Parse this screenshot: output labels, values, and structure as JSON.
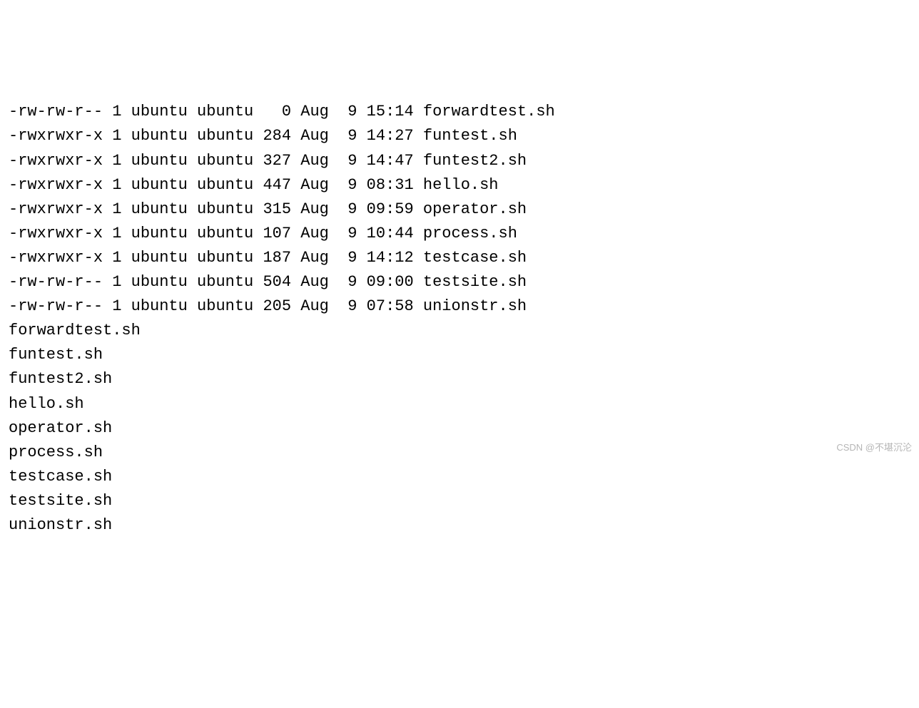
{
  "ls_long": [
    {
      "perms": "-rw-rw-r--",
      "links": "1",
      "owner": "ubuntu",
      "group": "ubuntu",
      "size": "0",
      "month": "Aug",
      "day": "9",
      "time": "15:14",
      "name": "forwardtest.sh"
    },
    {
      "perms": "-rwxrwxr-x",
      "links": "1",
      "owner": "ubuntu",
      "group": "ubuntu",
      "size": "284",
      "month": "Aug",
      "day": "9",
      "time": "14:27",
      "name": "funtest.sh"
    },
    {
      "perms": "-rwxrwxr-x",
      "links": "1",
      "owner": "ubuntu",
      "group": "ubuntu",
      "size": "327",
      "month": "Aug",
      "day": "9",
      "time": "14:47",
      "name": "funtest2.sh"
    },
    {
      "perms": "-rwxrwxr-x",
      "links": "1",
      "owner": "ubuntu",
      "group": "ubuntu",
      "size": "447",
      "month": "Aug",
      "day": "9",
      "time": "08:31",
      "name": "hello.sh"
    },
    {
      "perms": "-rwxrwxr-x",
      "links": "1",
      "owner": "ubuntu",
      "group": "ubuntu",
      "size": "315",
      "month": "Aug",
      "day": "9",
      "time": "09:59",
      "name": "operator.sh"
    },
    {
      "perms": "-rwxrwxr-x",
      "links": "1",
      "owner": "ubuntu",
      "group": "ubuntu",
      "size": "107",
      "month": "Aug",
      "day": "9",
      "time": "10:44",
      "name": "process.sh"
    },
    {
      "perms": "-rwxrwxr-x",
      "links": "1",
      "owner": "ubuntu",
      "group": "ubuntu",
      "size": "187",
      "month": "Aug",
      "day": "9",
      "time": "14:12",
      "name": "testcase.sh"
    },
    {
      "perms": "-rw-rw-r--",
      "links": "1",
      "owner": "ubuntu",
      "group": "ubuntu",
      "size": "504",
      "month": "Aug",
      "day": "9",
      "time": "09:00",
      "name": "testsite.sh"
    },
    {
      "perms": "-rw-rw-r--",
      "links": "1",
      "owner": "ubuntu",
      "group": "ubuntu",
      "size": "205",
      "month": "Aug",
      "day": "9",
      "time": "07:58",
      "name": "unionstr.sh"
    }
  ],
  "ls_short": [
    "forwardtest.sh",
    "funtest.sh",
    "funtest2.sh",
    "hello.sh",
    "operator.sh",
    "process.sh",
    "testcase.sh",
    "testsite.sh",
    "unionstr.sh"
  ],
  "watermark": "CSDN @不堪沉沦"
}
